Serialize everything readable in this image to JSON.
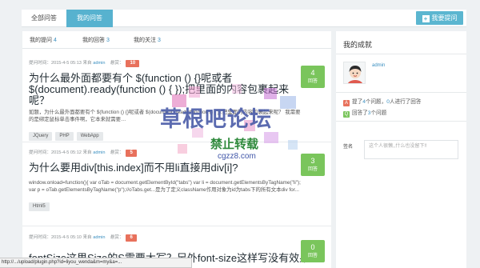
{
  "topnav": {
    "tabs": [
      "全部问答",
      "我的问答"
    ],
    "ask_button": "我要提问"
  },
  "subtabs": [
    {
      "label": "我的提问",
      "count": "4"
    },
    {
      "label": "我的回答",
      "count": "3"
    },
    {
      "label": "我的关注",
      "count": "3"
    }
  ],
  "questions": [
    {
      "meta_prefix": "提问时间：2015-4-5 05:13 来自",
      "author": "admin",
      "bounty_label": "悬赏：",
      "bounty": "10",
      "title": "为什么最外面都要有个 $(function () {}呢或者 $(document).ready(function () { });把里面的内容包裹起来呢？",
      "excerpt": "如题，为什么最外面都要有个 $(function () {}呢或者 $(document).ready(function () { });把里面的内容包裹起来呢？ 我需要的是绑定鼠标单击事件啊，它本来就需要…",
      "tags": [
        "JQuery",
        "PHP",
        "WebApp"
      ],
      "answers": "4",
      "answers_label": "回答"
    },
    {
      "meta_prefix": "提问时间：2015-4-5 05:12 来自",
      "author": "admin",
      "bounty_label": "悬赏：",
      "bounty": "5",
      "title": "为什么要用div[this.index]而不用li直接用div[i]?",
      "excerpt": "window.onload=function(){ var oTab = document.getElementById(\"tabs\") var li = document.getElementsByTagName(\"li\"); var p = oTab.getElementsByTagName(\"p\");//oTabs.get...是为了定义className作用对象为id为tabs下的所有文本div for...",
      "tags": [
        "Html5"
      ],
      "answers": "3",
      "answers_label": "回答"
    },
    {
      "meta_prefix": "提问时间：2015-4-5 05:10 来自",
      "author": "admin",
      "bounty_label": "悬赏：",
      "bounty": "6",
      "title": "fontSize这里Size的S需要大写？另外font-size这样写没有效果",
      "excerpt": "",
      "tags": [],
      "answers": "0",
      "answers_label": "回答"
    }
  ],
  "sidebar": {
    "title": "我的成就",
    "username": "admin",
    "stat1_pre": "提了",
    "stat1_num": "4",
    "stat1_mid": "个问题，",
    "stat1_num2": "0",
    "stat1_post": "人进行了回答",
    "stat2_pre": "回答了",
    "stat2_num": "3",
    "stat2_post": "个问题",
    "signature_label": "签名",
    "signature_text": "这个人很懒,,什么也没留下!!"
  },
  "watermark": {
    "main": "草根吧论坛",
    "sub": "禁止转载",
    "url": "cgzz8.com"
  },
  "statusbar": {
    "text": "http://.../upload/plugin.php?id=liyou_wenda&m=my&a=..."
  },
  "colors": {
    "accent": "#57b2cf",
    "bounty": "#e8715c",
    "answer_badge": "#7ac55c",
    "link": "#3a8fc0"
  }
}
